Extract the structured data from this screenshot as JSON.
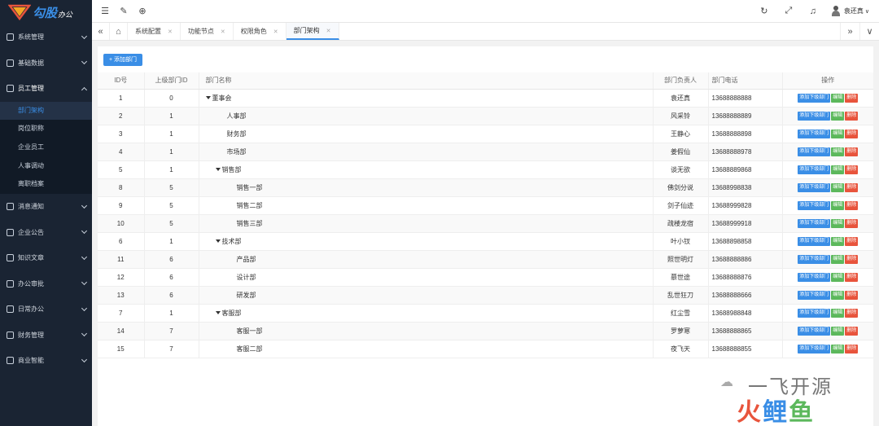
{
  "brand": {
    "logo_text": "勾股",
    "logo_sub": "办公"
  },
  "sidebar": {
    "items": [
      {
        "label": "系统管理"
      },
      {
        "label": "基础数据"
      },
      {
        "label": "员工管理",
        "open": true
      },
      {
        "label": "消息通知"
      },
      {
        "label": "企业公告"
      },
      {
        "label": "知识文章"
      },
      {
        "label": "办公审批"
      },
      {
        "label": "日常办公"
      },
      {
        "label": "财务管理"
      },
      {
        "label": "商业智能"
      }
    ],
    "sub_items": [
      {
        "label": "部门架构",
        "active": true
      },
      {
        "label": "岗位职称"
      },
      {
        "label": "企业员工"
      },
      {
        "label": "人事调动"
      },
      {
        "label": "离职档案"
      }
    ]
  },
  "header": {
    "user_name": "袁还真"
  },
  "tabs": [
    {
      "label": "系统配置"
    },
    {
      "label": "功能节点"
    },
    {
      "label": "权限角色"
    },
    {
      "label": "部门架构",
      "active": true
    }
  ],
  "toolbar": {
    "add_label": "+ 添加部门"
  },
  "table": {
    "headers": {
      "id": "ID号",
      "pid": "上级部门ID",
      "name": "部门名称",
      "manager": "部门负责人",
      "phone": "部门电话",
      "ops": "操作"
    },
    "op_labels": {
      "add": "添加下级部门",
      "edit": "编辑",
      "del": "删除"
    },
    "rows": [
      {
        "id": "1",
        "pid": "0",
        "name": "董事会",
        "level": 0,
        "tree": true,
        "manager": "袁还真",
        "phone": "13688888888"
      },
      {
        "id": "2",
        "pid": "1",
        "name": "人事部",
        "level": 1,
        "tree": false,
        "manager": "风采铃",
        "phone": "13688888889"
      },
      {
        "id": "3",
        "pid": "1",
        "name": "财务部",
        "level": 1,
        "tree": false,
        "manager": "王静心",
        "phone": "13688888898"
      },
      {
        "id": "4",
        "pid": "1",
        "name": "市场部",
        "level": 1,
        "tree": false,
        "manager": "姜假仙",
        "phone": "13688888978"
      },
      {
        "id": "5",
        "pid": "1",
        "name": "销售部",
        "level": 1,
        "tree": true,
        "manager": "谈无欲",
        "phone": "13688889868"
      },
      {
        "id": "8",
        "pid": "5",
        "name": "销售一部",
        "level": 2,
        "tree": false,
        "manager": "佛剑分说",
        "phone": "13688998838"
      },
      {
        "id": "9",
        "pid": "5",
        "name": "销售二部",
        "level": 2,
        "tree": false,
        "manager": "剑子仙迹",
        "phone": "13688999828"
      },
      {
        "id": "10",
        "pid": "5",
        "name": "销售三部",
        "level": 2,
        "tree": false,
        "manager": "疏楼龙宿",
        "phone": "13688999918"
      },
      {
        "id": "6",
        "pid": "1",
        "name": "技术部",
        "level": 1,
        "tree": true,
        "manager": "叶小钗",
        "phone": "13688898858"
      },
      {
        "id": "11",
        "pid": "6",
        "name": "产品部",
        "level": 2,
        "tree": false,
        "manager": "照世明灯",
        "phone": "13688888886"
      },
      {
        "id": "12",
        "pid": "6",
        "name": "设计部",
        "level": 2,
        "tree": false,
        "manager": "慕世途",
        "phone": "13688888876"
      },
      {
        "id": "13",
        "pid": "6",
        "name": "研发部",
        "level": 2,
        "tree": false,
        "manager": "乱世狂刀",
        "phone": "13688888666"
      },
      {
        "id": "7",
        "pid": "1",
        "name": "客服部",
        "level": 1,
        "tree": true,
        "manager": "红尘雪",
        "phone": "13688988848"
      },
      {
        "id": "14",
        "pid": "7",
        "name": "客服一部",
        "level": 2,
        "tree": false,
        "manager": "罗萝寒",
        "phone": "13688888865"
      },
      {
        "id": "15",
        "pid": "7",
        "name": "客服二部",
        "level": 2,
        "tree": false,
        "manager": "夜飞天",
        "phone": "13688888855"
      }
    ]
  },
  "watermark": {
    "line1": "一飞开源",
    "line2_a": "火",
    "line2_b": "鲤",
    "line2_c": "鱼"
  }
}
